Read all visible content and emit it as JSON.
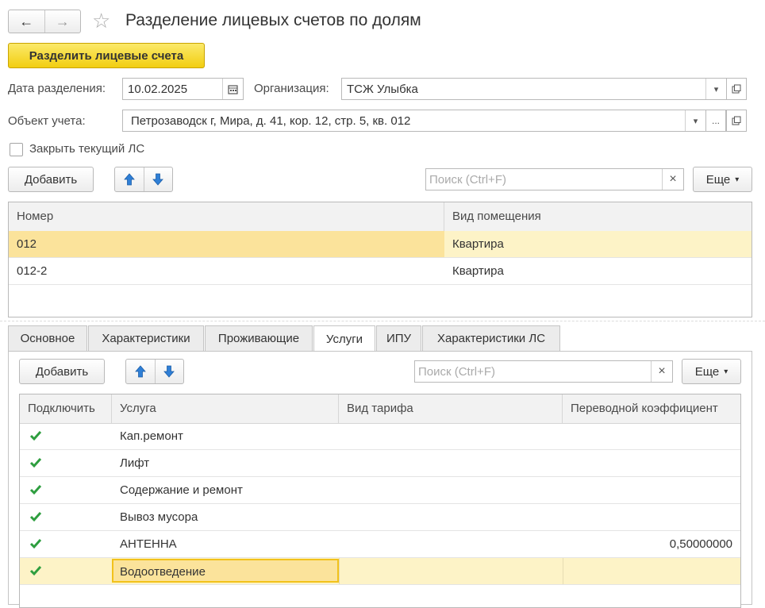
{
  "window": {
    "title": "Разделение лицевых счетов по долям",
    "nav_back": "←",
    "nav_forward": "→",
    "favorite_icon": "star-icon"
  },
  "toolbar": {
    "split_label": "Разделить лицевые счета"
  },
  "form": {
    "date_label": "Дата разделения:",
    "date_value": "10.02.2025",
    "org_label": "Организация:",
    "org_value": "ТСЖ Улыбка",
    "object_label": "Объект учета:",
    "object_value": "Петрозаводск г, Мира, д. 41, кор. 12, стр. 5, кв. 012",
    "close_label": "Закрыть текущий ЛС",
    "close_checked": false
  },
  "accounts": {
    "add_label": "Добавить",
    "search_placeholder": "Поиск (Ctrl+F)",
    "clear": "×",
    "more_label": "Еще",
    "columns": [
      "Номер",
      "Вид помещения"
    ],
    "rows": [
      {
        "number": "012",
        "type": "Квартира",
        "selected": true
      },
      {
        "number": "012-2",
        "type": "Квартира",
        "selected": false
      }
    ]
  },
  "tabs": [
    {
      "label": "Основное",
      "active": false
    },
    {
      "label": "Характеристики",
      "active": false
    },
    {
      "label": "Проживающие",
      "active": false
    },
    {
      "label": "Услуги",
      "active": true
    },
    {
      "label": "ИПУ",
      "active": false
    },
    {
      "label": "Характеристики ЛС",
      "active": false
    }
  ],
  "services": {
    "add_label": "Добавить",
    "search_placeholder": "Поиск (Ctrl+F)",
    "clear": "×",
    "more_label": "Еще",
    "columns": [
      "Подключить",
      "Услуга",
      "Вид тарифа",
      "Переводной коэффициент"
    ],
    "rows": [
      {
        "enabled": true,
        "service": "Кап.ремонт",
        "tariff": "",
        "coef": ""
      },
      {
        "enabled": true,
        "service": "Лифт",
        "tariff": "",
        "coef": ""
      },
      {
        "enabled": true,
        "service": "Содержание и ремонт",
        "tariff": "",
        "coef": ""
      },
      {
        "enabled": true,
        "service": "Вывоз мусора",
        "tariff": "",
        "coef": ""
      },
      {
        "enabled": true,
        "service": "АНТЕННА",
        "tariff": "",
        "coef": "0,50000000"
      },
      {
        "enabled": true,
        "service": "Водоотведение",
        "tariff": "",
        "coef": "",
        "selected": true
      }
    ]
  },
  "colors": {
    "accent_yellow": "#f2ce10",
    "selection": "#fdf3c7",
    "check_green": "#2e9e3f",
    "arrow_blue": "#2f7fd6"
  }
}
